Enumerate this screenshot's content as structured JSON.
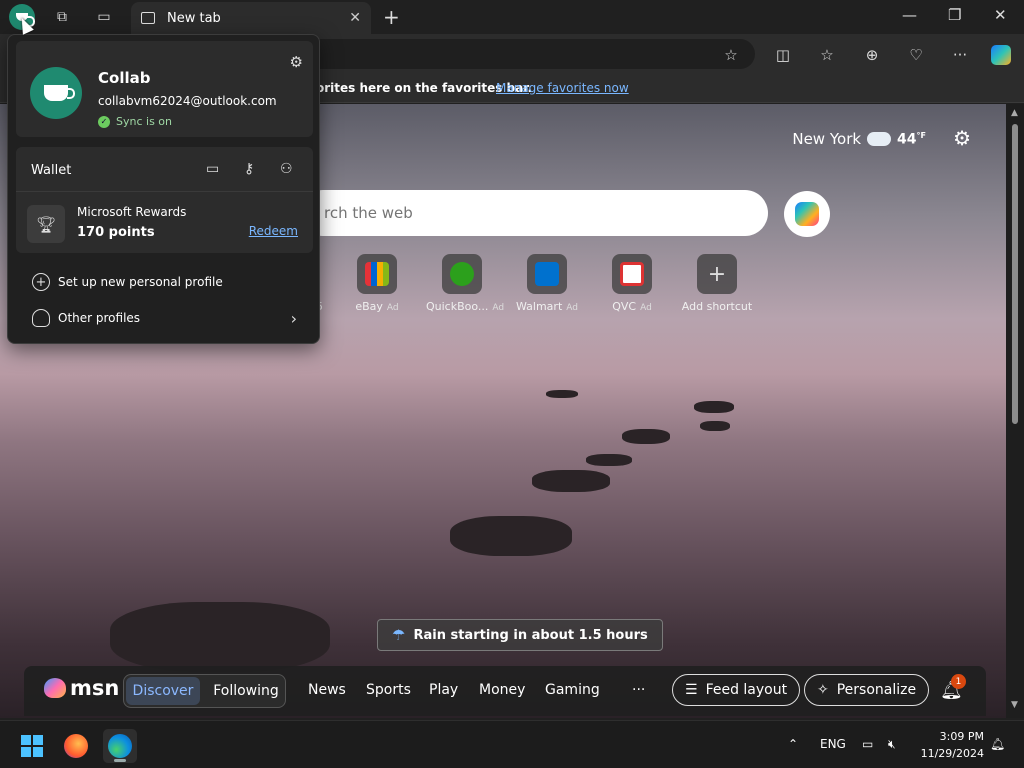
{
  "browser": {
    "tab": {
      "title": "New tab"
    },
    "favorites_bar": {
      "message": "orites here on the favorites bar.",
      "manage_link": "Manage favorites now"
    },
    "icons": [
      "profile-icon",
      "workspaces-icon",
      "tab-actions-icon",
      "new-tab-icon",
      "minimize-icon",
      "restore-icon",
      "close-icon",
      "favorite-star-icon",
      "split-screen-icon",
      "favorites-icon",
      "collections-icon",
      "browser-essentials-icon",
      "more-icon",
      "copilot-icon"
    ]
  },
  "profile_menu": {
    "name": "Collab",
    "email": "collabvm62024@outlook.com",
    "sync_status": "Sync is on",
    "wallet": {
      "title": "Wallet",
      "rewards_title": "Microsoft Rewards",
      "rewards_points": "170 points",
      "redeem_label": "Redeem"
    },
    "items": [
      {
        "label": "Set up new personal profile"
      },
      {
        "label": "Other profiles"
      }
    ]
  },
  "newtab": {
    "weather": {
      "city": "New York",
      "temp": "44",
      "unit": "°F"
    },
    "search_placeholder": "rch the web",
    "partial_shortcut_label": "5",
    "shortcuts": [
      {
        "label": "eBay",
        "ad": "Ad",
        "color": "#e53238"
      },
      {
        "label": "QuickBoo...",
        "ad": "Ad",
        "color": "#2ca01c"
      },
      {
        "label": "Walmart",
        "ad": "Ad",
        "color": "#0071ce"
      },
      {
        "label": "QVC",
        "ad": "Ad",
        "color": "#ffffff"
      },
      {
        "label": "Add shortcut",
        "ad": ""
      }
    ],
    "rain_notice": "Rain starting in about 1.5 hours"
  },
  "msn_bar": {
    "logo": "msn",
    "tabs": [
      "Discover",
      "Following"
    ],
    "links": [
      "News",
      "Sports",
      "Play",
      "Money",
      "Gaming"
    ],
    "more": "···",
    "feed_layout": "Feed layout",
    "personalize": "Personalize",
    "notification_count": "1"
  },
  "taskbar": {
    "language": "ENG",
    "time": "3:09 PM",
    "date": "11/29/2024"
  }
}
